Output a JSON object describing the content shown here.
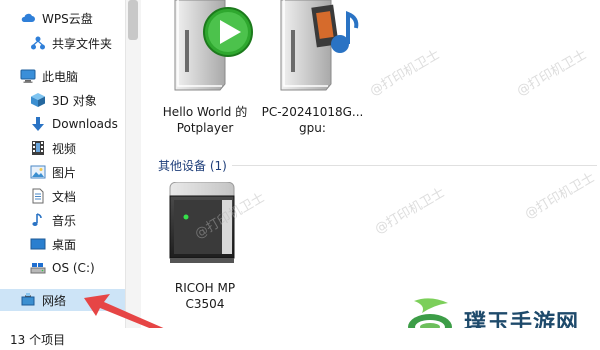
{
  "sidebar": {
    "items": [
      {
        "label": "WPS云盘",
        "icon": "cloud-icon"
      },
      {
        "label": "共享文件夹",
        "icon": "share-icon"
      },
      {
        "label": "此电脑",
        "icon": "computer-icon"
      },
      {
        "label": "3D 对象",
        "icon": "3d-objects-icon"
      },
      {
        "label": "Downloads",
        "icon": "download-arrow-icon"
      },
      {
        "label": "视频",
        "icon": "video-icon"
      },
      {
        "label": "图片",
        "icon": "picture-icon"
      },
      {
        "label": "文档",
        "icon": "document-icon"
      },
      {
        "label": "音乐",
        "icon": "music-icon"
      },
      {
        "label": "桌面",
        "icon": "desktop-icon"
      },
      {
        "label": "OS (C:)",
        "icon": "drive-icon"
      },
      {
        "label": "网络",
        "icon": "network-icon"
      }
    ],
    "selected": "网络"
  },
  "main": {
    "media_devices": [
      {
        "label_line1": "Hello World 的",
        "label_line2": "Potplayer",
        "icon": "media-server-play-icon"
      },
      {
        "label_line1": "PC-20241018G...",
        "label_line2": "gpu:",
        "icon": "media-server-music-icon"
      }
    ],
    "other_group": {
      "header": "其他设备 (1)",
      "devices": [
        {
          "label_line1": "RICOH MP",
          "label_line2": "C3504",
          "icon": "printer-device-icon"
        }
      ]
    }
  },
  "status_bar": {
    "item_count": "13 个项目"
  },
  "watermark": "@打印机卫士",
  "brand": {
    "name": "璞玉手游网"
  },
  "colors": {
    "selected_bg": "#cde4f7",
    "arrow": "#e64545",
    "brand": "#1e4a6b",
    "group_header": "#1e3e7a"
  }
}
